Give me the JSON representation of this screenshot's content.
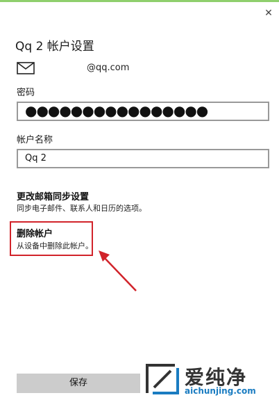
{
  "window": {
    "close_symbol": "✕"
  },
  "header": {
    "title": "Qq 2 帐户设置"
  },
  "account": {
    "email": "@qq.com",
    "email_icon": "mail-icon"
  },
  "password": {
    "label": "密码",
    "value": "●●●●●●●●●●●●●●●●"
  },
  "account_name": {
    "label": "帐户名称",
    "value": "Qq 2"
  },
  "sync_settings": {
    "title": "更改邮箱同步设置",
    "desc": "同步电子邮件、联系人和日历的选项。"
  },
  "delete_account": {
    "title": "删除帐户",
    "desc": "从设备中删除此帐户。"
  },
  "footer": {
    "save_label": "保存"
  },
  "watermark": {
    "text": "爱纯净",
    "url": "aichunjing.com"
  },
  "colors": {
    "accent_line": "#8fcf6d",
    "annotation": "#d1232a",
    "button_bg": "#cccccc"
  }
}
